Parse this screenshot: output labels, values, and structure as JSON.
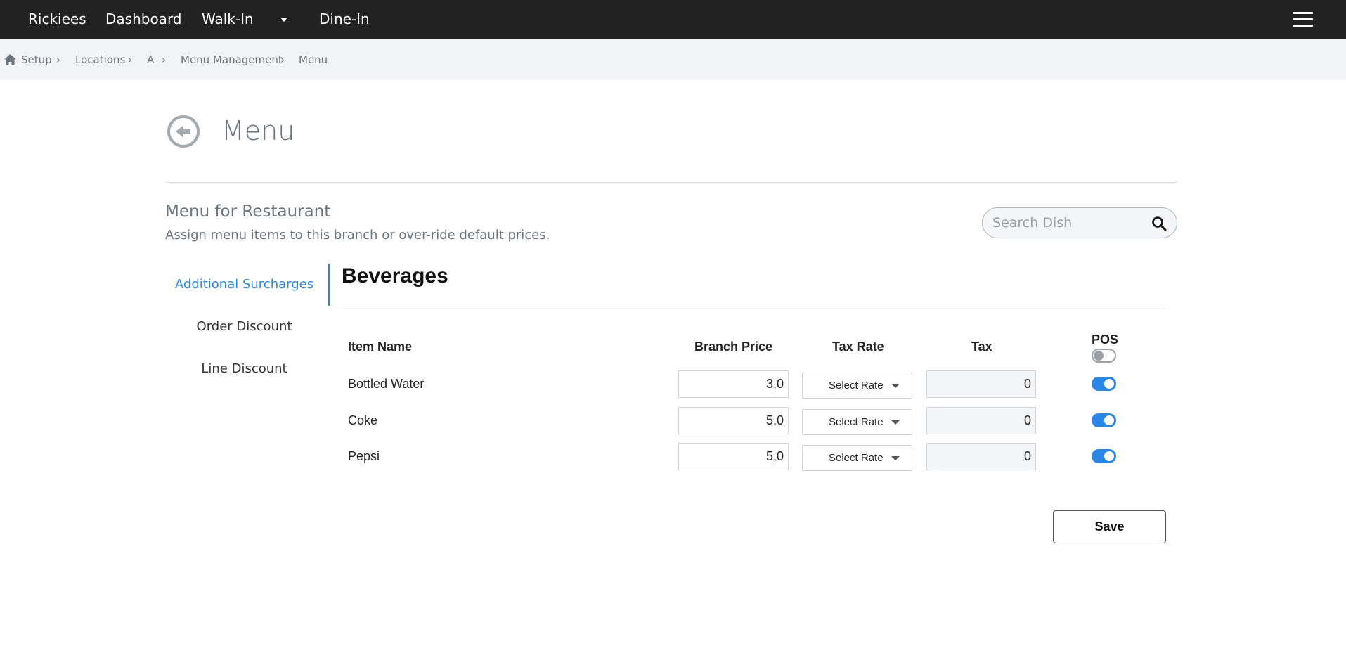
{
  "navbar": {
    "brand": "Rickiees",
    "items": [
      "Dashboard",
      "Walk-In",
      "Dine-In"
    ]
  },
  "breadcrumb": {
    "items": [
      "Setup",
      "Locations",
      "A",
      "Menu Management",
      "Menu"
    ],
    "separator": "›"
  },
  "header": {
    "title": "Menu"
  },
  "section": {
    "title": "Menu for Restaurant",
    "subtitle": "Assign menu items to this branch or over-ride default prices."
  },
  "search": {
    "placeholder": "Search Dish"
  },
  "sidebar": {
    "items": [
      {
        "label": "Additional Surcharges",
        "active": true
      },
      {
        "label": "Order Discount",
        "active": false
      },
      {
        "label": "Line Discount",
        "active": false
      }
    ]
  },
  "category": {
    "title": "Beverages"
  },
  "table": {
    "columns": {
      "item_name": "Item Name",
      "branch_price": "Branch Price",
      "tax_rate": "Tax Rate",
      "tax": "Tax",
      "pos": "POS"
    },
    "pos_all_enabled": false,
    "rows": [
      {
        "name": "Bottled Water",
        "price": "3,0",
        "rate": "Select Rate",
        "tax": "0",
        "pos": true
      },
      {
        "name": "Coke",
        "price": "5,0",
        "rate": "Select Rate",
        "tax": "0",
        "pos": true
      },
      {
        "name": "Pepsi",
        "price": "5,0",
        "rate": "Select Rate",
        "tax": "0",
        "pos": true
      }
    ]
  },
  "actions": {
    "save_label": "Save"
  },
  "colors": {
    "navbar_bg": "#222222",
    "accent": "#2b86e3",
    "breadcrumb_bg": "#f2f3f5"
  }
}
